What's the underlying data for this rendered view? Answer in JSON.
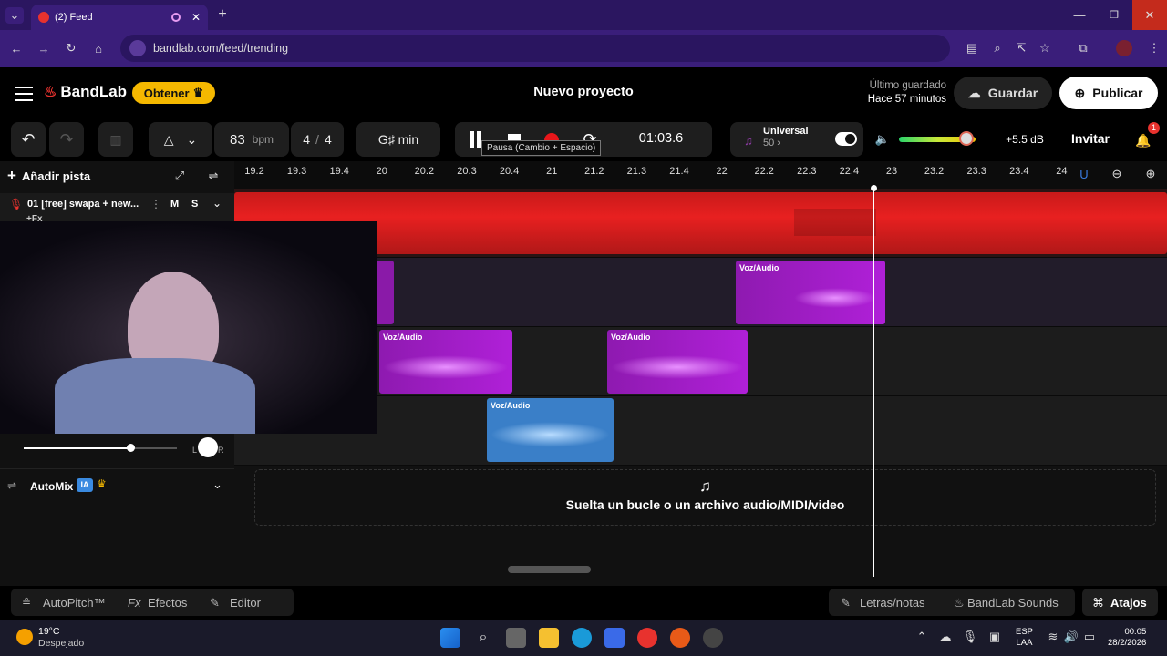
{
  "browser": {
    "tab_title": "(2) Feed",
    "url": "bandlab.com/feed/trending"
  },
  "app": {
    "logo": "BandLab",
    "obtener": "Obtener",
    "project_title": "Nuevo proyecto",
    "saved_label": "Último guardado",
    "saved_time": "Hace 57 minutos",
    "guardar": "Guardar",
    "publicar": "Publicar"
  },
  "transport": {
    "bpm": "83",
    "bpm_unit": "bpm",
    "sig_num": "4",
    "sig_sep": "/",
    "sig_den": "4",
    "key": "G♯ min",
    "time": "01:03.6",
    "tooltip": "Pausa (Cambio + Espacio)",
    "preset_name": "Universal",
    "preset_val": "50 ›",
    "db": "+5.5 dB",
    "invitar": "Invitar",
    "notif_count": "1",
    "volume_level": 0.88
  },
  "ruler": {
    "ticks": [
      "19.2",
      "19.3",
      "19.4",
      "20",
      "20.2",
      "20.3",
      "20.4",
      "21",
      "21.2",
      "21.3",
      "21.4",
      "22",
      "22.2",
      "22.3",
      "22.4",
      "23",
      "23.2",
      "23.3",
      "23.4",
      "24"
    ]
  },
  "tracks": {
    "add": "Añadir pista",
    "track_name": "01  [free] swapa + new...",
    "mute": "M",
    "solo": "S",
    "fx": "+Fx",
    "pan_l": "L",
    "pan_r": "R",
    "clip_label": "Voz/Audio",
    "automix": "AutoMix",
    "ia": "IA",
    "drop_text": "Suelta un bucle o un archivo audio/MIDI/video"
  },
  "footer": {
    "autopitch": "AutoPitch™",
    "fx_prefix": "Fx",
    "efectos": "Efectos",
    "editor": "Editor",
    "letras": "Letras/notas",
    "sounds": "BandLab Sounds",
    "atajos": "Atajos"
  },
  "taskbar": {
    "temp": "19°C",
    "weather": "Despejado",
    "lang1": "ESP",
    "lang2": "LAA",
    "time": "00:05",
    "date": "28/2/2026"
  }
}
